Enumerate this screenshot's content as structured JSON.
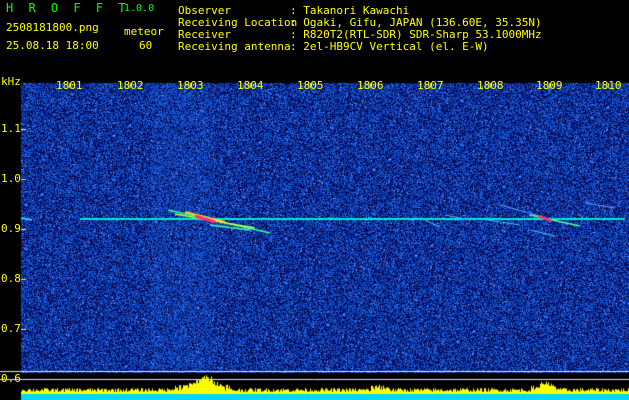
{
  "header": {
    "app_name": "H R O F F T",
    "version": "1.0.0",
    "filename": "2508181800.png",
    "datetime": "25.08.18 18:00",
    "meteor_label": "meteor",
    "meteor_count": "60",
    "info": [
      {
        "label": "Observer",
        "value": ": Takanori Kawachi"
      },
      {
        "label": "Receiving Location",
        "value": ": Ogaki, Gifu, JAPAN (136.60E, 35.35N)"
      },
      {
        "label": "Receiver",
        "value": ": R820T2(RTL-SDR) SDR-Sharp 53.1000MHz"
      },
      {
        "label": "Receiving antenna",
        "value": ": 2el-HB9CV Vertical (el. E-W)"
      }
    ]
  },
  "axis": {
    "unit": "kHz",
    "time_ticks": [
      "1801",
      "1802",
      "1803",
      "1804",
      "1805",
      "1806",
      "1807",
      "1808",
      "1809",
      "1810"
    ],
    "freq_ticks": [
      "1.1",
      "1.0",
      "0.9",
      "0.8",
      "0.7",
      "0.6"
    ]
  },
  "colors": {
    "noise_bg": "#1a2fa0",
    "carrier": "#00ffcc",
    "meteor_hot": "#ff3070",
    "meteor_warm": "#ffff40",
    "tick_text": "#ffff00",
    "grid": "#ffffff",
    "histogram": "#ffff00",
    "histogram_base": "#00e0ff"
  }
}
